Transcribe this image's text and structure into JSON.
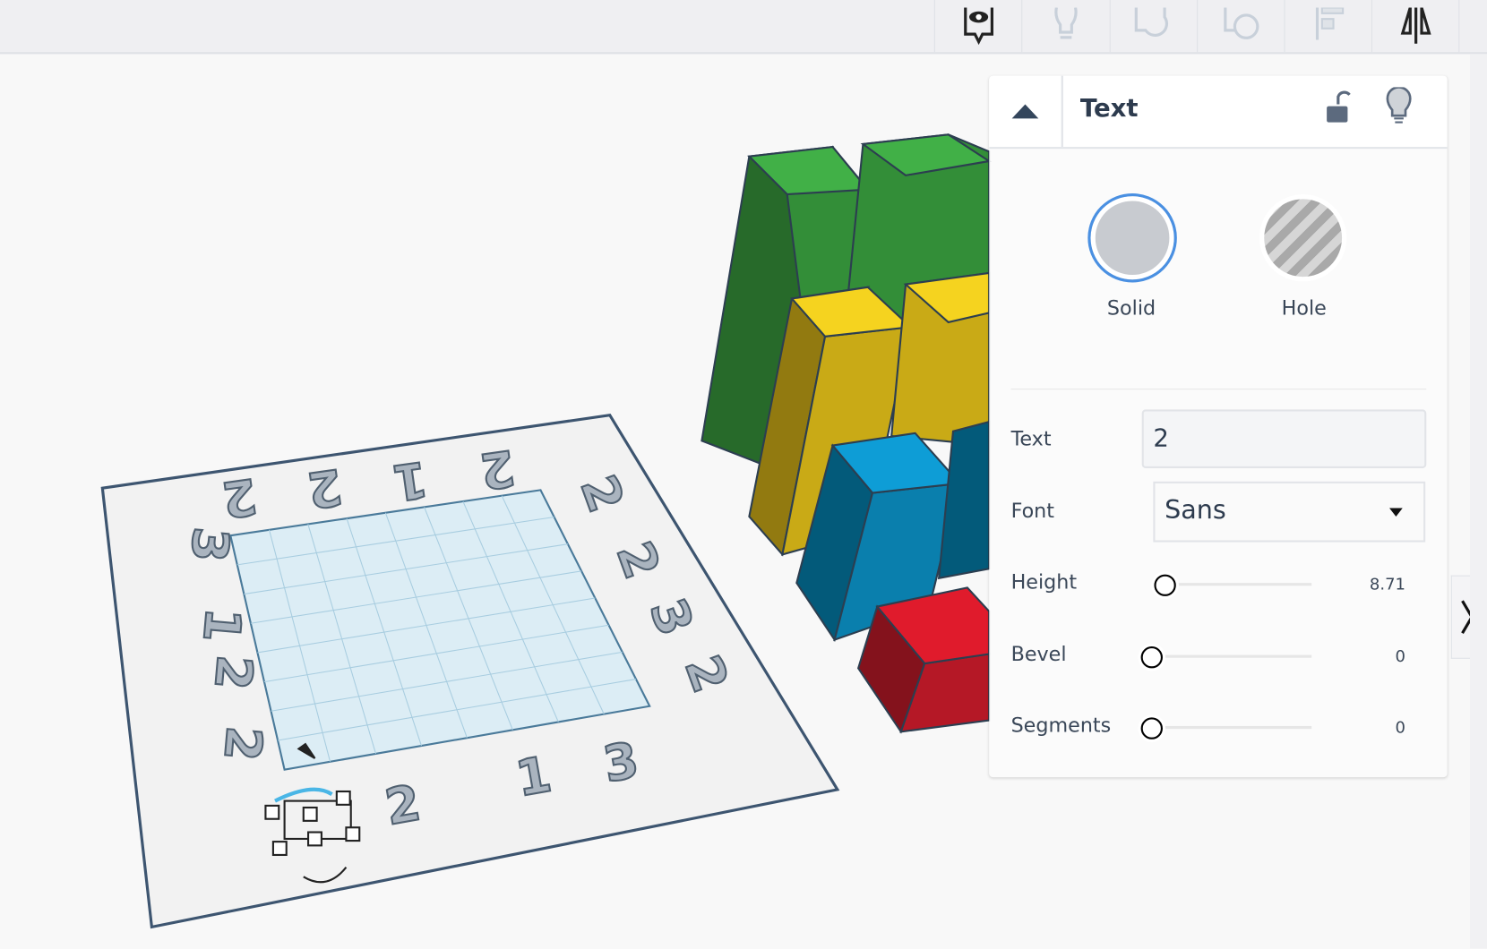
{
  "toolbar": {
    "icons": [
      "notes-icon",
      "lightbulb-icon",
      "group-icon",
      "ungroup-icon",
      "align-icon",
      "mirror-icon"
    ]
  },
  "scene": {
    "plate_labels": {
      "top": [
        "2",
        "2",
        "1",
        "2"
      ],
      "right": [
        "2",
        "2",
        "3",
        "2"
      ],
      "bottom": [
        "2",
        "1",
        "3"
      ],
      "left": [
        "3",
        "1",
        "2",
        "2"
      ]
    },
    "bar_colors": {
      "green": "#3aa63f",
      "yellow": "#f2cf1d",
      "blue": "#0e9dd6",
      "red": "#e01b2c"
    }
  },
  "panel": {
    "title": "Text",
    "shape_types": [
      {
        "label": "Solid",
        "color": "#c8cbd0",
        "selected": true
      },
      {
        "label": "Hole",
        "color": "#a9a9a9",
        "selected": false
      }
    ],
    "fields": {
      "text": {
        "label": "Text",
        "value": "2"
      },
      "font": {
        "label": "Font",
        "value": "Sans"
      },
      "height": {
        "label": "Height",
        "value": "8.71"
      },
      "bevel": {
        "label": "Bevel",
        "value": "0"
      },
      "segments": {
        "label": "Segments",
        "value": "0"
      }
    }
  },
  "accent": "#4a90e2"
}
